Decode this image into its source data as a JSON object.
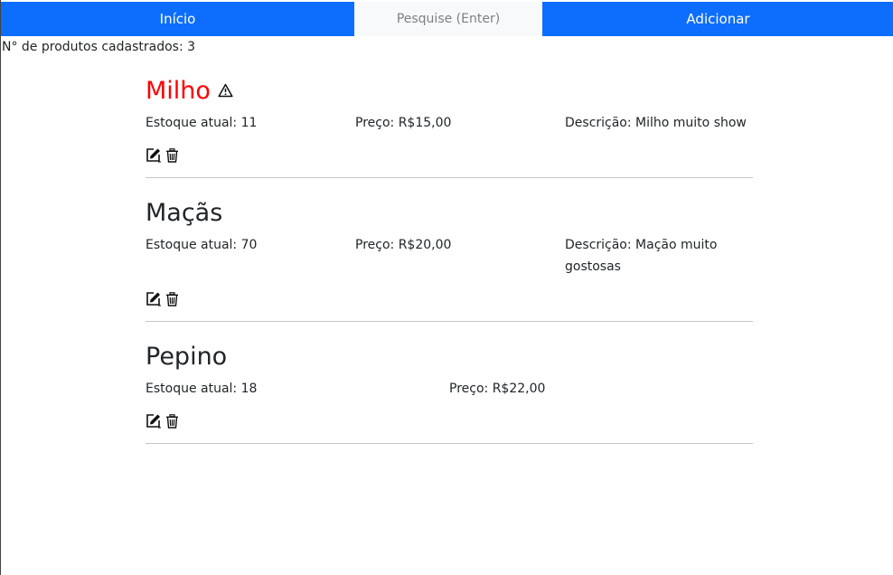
{
  "nav": {
    "home_label": "Início",
    "search_placeholder": "Pesquise (Enter)",
    "add_label": "Adicionar"
  },
  "summary": {
    "count_text": "N° de produtos cadastrados: 3"
  },
  "products": [
    {
      "name": "Milho",
      "low_stock": true,
      "stock": "Estoque atual: 11",
      "price": "Preço: R$15,00",
      "description": "Descrição: Milho muito show"
    },
    {
      "name": "Maçãs",
      "low_stock": false,
      "stock": "Estoque atual: 70",
      "price": "Preço: R$20,00",
      "description": "Descrição: Mação muito gostosas"
    },
    {
      "name": "Pepino",
      "low_stock": false,
      "stock": "Estoque atual: 18",
      "price": "Preço: R$22,00"
    }
  ],
  "colors": {
    "nav_bg": "#0d6efd",
    "low_stock_name": "#ff0000",
    "search_bg": "#f8f9fa"
  },
  "icons": [
    "warning-icon",
    "edit-icon",
    "trash-icon"
  ]
}
